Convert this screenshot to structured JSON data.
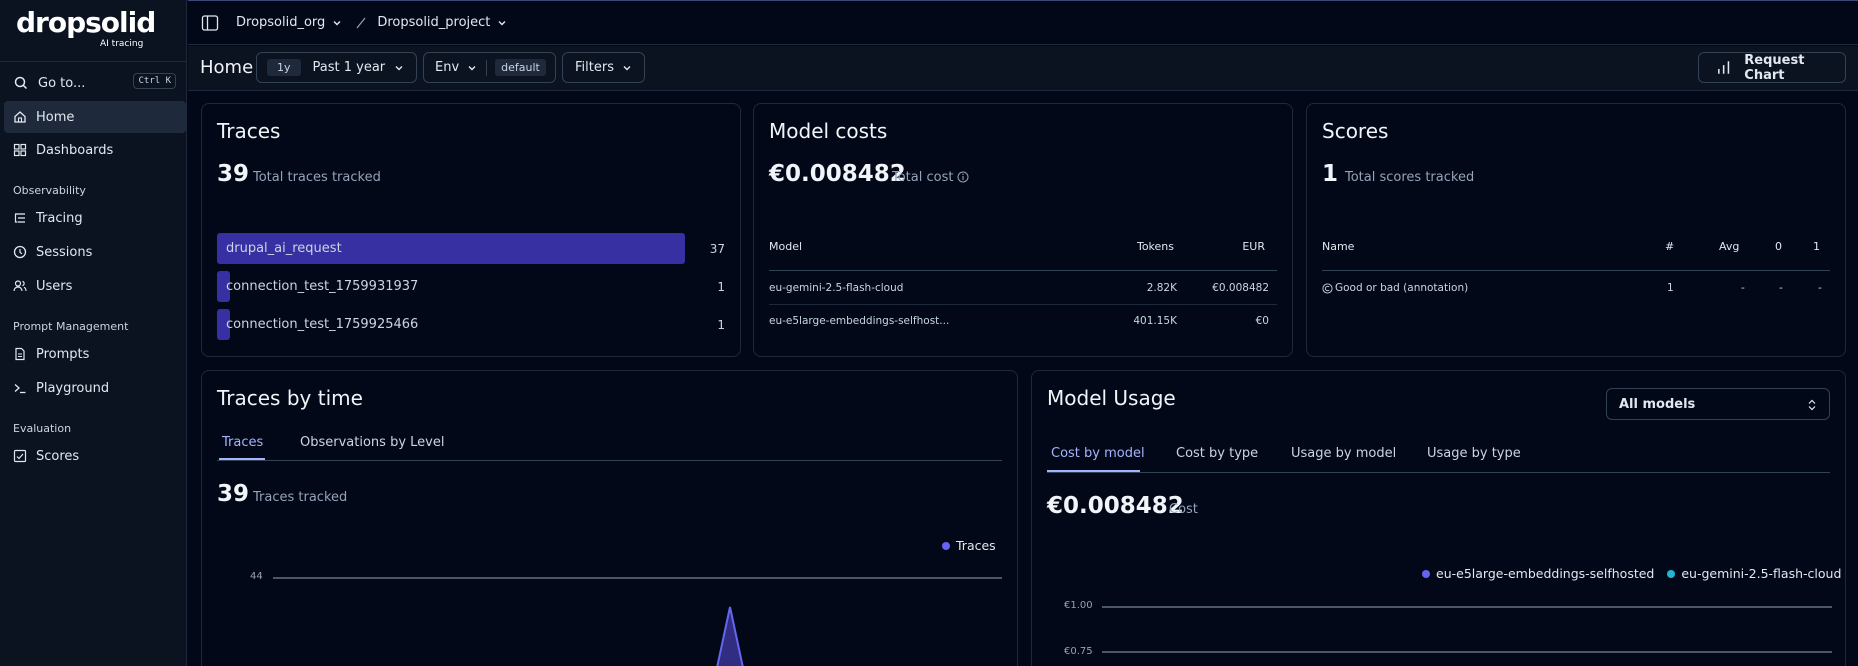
{
  "brand": {
    "name": "dropsolid",
    "subtitle": "AI tracing"
  },
  "goto": {
    "label": "Go to...",
    "shortcut": "Ctrl K"
  },
  "nav": {
    "home": "Home",
    "dashboards": "Dashboards",
    "observability": "Observability",
    "tracing": "Tracing",
    "sessions": "Sessions",
    "users": "Users",
    "prompt_management": "Prompt Management",
    "prompts": "Prompts",
    "playground": "Playground",
    "evaluation": "Evaluation",
    "scores": "Scores"
  },
  "breadcrumb": {
    "org": "Dropsolid_org",
    "project": "Dropsolid_project"
  },
  "toolbar": {
    "page": "Home",
    "range_short": "1y",
    "range": "Past 1 year",
    "env": "Env",
    "env_value": "default",
    "filters": "Filters",
    "request_chart": "Request Chart"
  },
  "traces": {
    "title": "Traces",
    "count": "39",
    "count_label": "Total traces tracked",
    "rows": [
      {
        "name": "drupal_ai_request",
        "value": "37",
        "share": 1.0
      },
      {
        "name": "connection_test_1759931937",
        "value": "1",
        "share": 0.027
      },
      {
        "name": "connection_test_1759925466",
        "value": "1",
        "share": 0.027
      }
    ]
  },
  "model_costs": {
    "title": "Model costs",
    "total": "€0.008482",
    "total_label": "Total cost",
    "headers": {
      "model": "Model",
      "tokens": "Tokens",
      "eur": "EUR"
    },
    "rows": [
      {
        "model": "eu-gemini-2.5-flash-cloud",
        "tokens": "2.82K",
        "eur": "€0.008482"
      },
      {
        "model": "eu-e5large-embeddings-selfhost...",
        "tokens": "401.15K",
        "eur": "€0"
      }
    ]
  },
  "scores": {
    "title": "Scores",
    "count": "1",
    "count_label": "Total scores tracked",
    "headers": {
      "name": "Name",
      "count": "#",
      "avg": "Avg",
      "zero": "0",
      "one": "1"
    },
    "rows": [
      {
        "name": "Good or bad (annotation)",
        "count": "1",
        "avg": "-",
        "zero": "-",
        "one": "-"
      }
    ]
  },
  "traces_by_time": {
    "title": "Traces by time",
    "tabs": [
      "Traces",
      "Observations by Level"
    ],
    "count": "39",
    "count_label": "Traces tracked",
    "chart_data": {
      "type": "line",
      "series": [
        {
          "name": "Traces",
          "color": "#6366f1"
        }
      ],
      "y_ticks": [
        "44"
      ]
    }
  },
  "model_usage": {
    "title": "Model Usage",
    "select": "All models",
    "tabs": [
      "Cost by model",
      "Cost by type",
      "Usage by model",
      "Usage by type"
    ],
    "total": "€0.008482",
    "total_label": "Cost",
    "chart_data": {
      "type": "line",
      "series": [
        {
          "name": "eu-e5large-embeddings-selfhosted",
          "color": "#6366f1"
        },
        {
          "name": "eu-gemini-2.5-flash-cloud",
          "color": "#22b5d4"
        }
      ],
      "y_ticks": [
        "€1.00",
        "€0.75"
      ]
    }
  }
}
